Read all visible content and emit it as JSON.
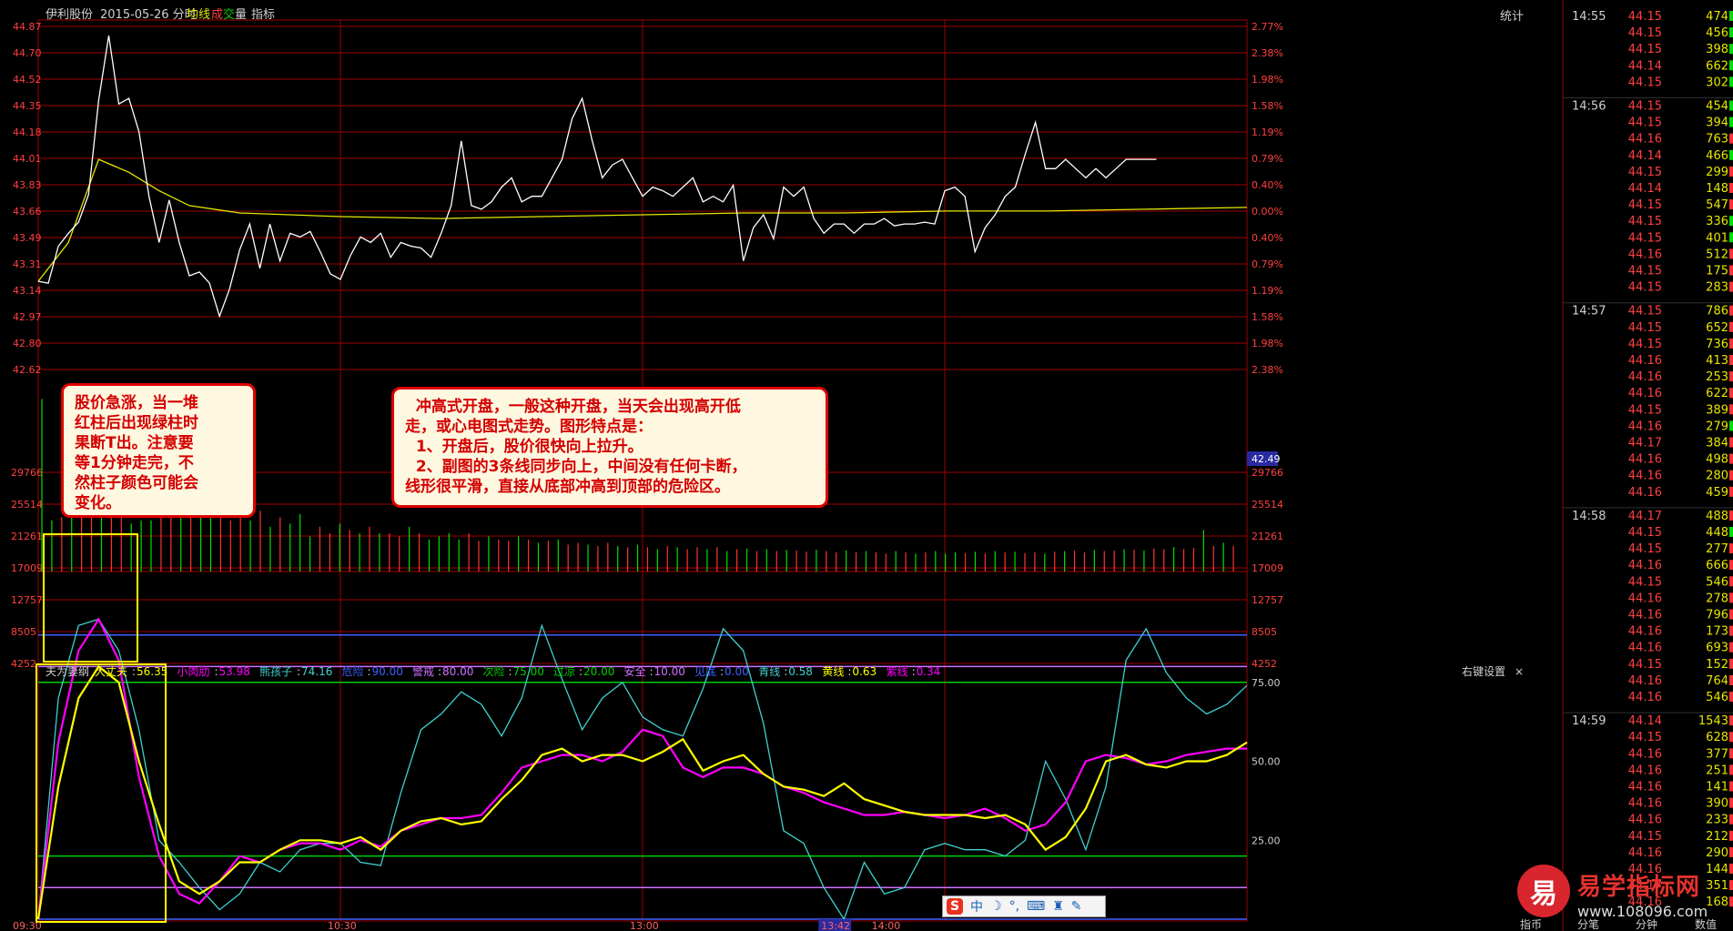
{
  "header": {
    "stock_name": "伊利股份",
    "date_label": "2015-05-26 分时",
    "avg_line_label": "均线",
    "volume_label_cheng": "成",
    "volume_label_jiao": "交",
    "volume_label_liang": "量",
    "indicator_label": "指标",
    "stats_label": "统计"
  },
  "colors": {
    "price_line": "#ffffff",
    "avg_line": "#e6e600",
    "grid_red": "#a00000",
    "up": "#ff3232",
    "down": "#00e000",
    "axis_text_left": "#ff4040",
    "axis_text_right": "#ff4040",
    "ind_cyan": "#40d0d0",
    "ind_magenta": "#ff00ff",
    "ind_yellow": "#ffff00",
    "level_blue": "#4060ff",
    "level_purple": "#d070ff",
    "level_green": "#00d000",
    "highlight_box": "#ffff00"
  },
  "chart_data": {
    "type": "line",
    "price_axis_labels": [
      "44.87",
      "44.70",
      "44.52",
      "44.35",
      "44.18",
      "44.01",
      "43.83",
      "43.66",
      "43.49",
      "43.31",
      "43.14",
      "42.97",
      "42.80",
      "42.62"
    ],
    "percent_axis_labels": [
      "2.77%",
      "2.38%",
      "1.98%",
      "1.58%",
      "1.19%",
      "0.79%",
      "0.40%",
      "0.00%",
      "0.40%",
      "0.79%",
      "1.19%",
      "1.58%",
      "1.98%",
      "2.38%"
    ],
    "current_price_tag": "42.49",
    "volume_axis_labels": [
      "29766",
      "25514",
      "21261",
      "17009",
      "12757",
      "8505",
      "4252"
    ],
    "time_labels": [
      "09:30",
      "10:30",
      "13:00",
      "13:42",
      "14:00"
    ],
    "ylim_price": [
      42.49,
      44.87
    ],
    "price_series": {
      "x": [
        0,
        2,
        4,
        6,
        8,
        10,
        12,
        14,
        16,
        18,
        20,
        22,
        24,
        26,
        28,
        30,
        32,
        34,
        36,
        38,
        40,
        42,
        44,
        46,
        48,
        50,
        52,
        54,
        56,
        58,
        60,
        62,
        64,
        66,
        68,
        70,
        72,
        74,
        76,
        78,
        80,
        82,
        84,
        86,
        88,
        90,
        92,
        94,
        96,
        98,
        100,
        102,
        104,
        106,
        108,
        110,
        112,
        114,
        116,
        118,
        120,
        122,
        124,
        126,
        128,
        130,
        132,
        134,
        136,
        138,
        140,
        142,
        144,
        146,
        148,
        150,
        152,
        154,
        156,
        158,
        160,
        162,
        164,
        166,
        168,
        170,
        172,
        174,
        176,
        178,
        180,
        182,
        184,
        186,
        188,
        190,
        192,
        194,
        196,
        198,
        200,
        202,
        204,
        206,
        208,
        210,
        212,
        214,
        216,
        218,
        220,
        222,
        224,
        226,
        228,
        230,
        232,
        234,
        236,
        238,
        240
      ],
      "values": [
        43.49,
        43.48,
        43.68,
        43.75,
        43.81,
        43.96,
        44.47,
        44.82,
        44.45,
        44.48,
        44.3,
        43.95,
        43.7,
        43.93,
        43.7,
        43.52,
        43.54,
        43.48,
        43.3,
        43.45,
        43.66,
        43.8,
        43.56,
        43.8,
        43.6,
        43.75,
        43.73,
        43.76,
        43.65,
        43.53,
        43.5,
        43.63,
        43.73,
        43.7,
        43.75,
        43.62,
        43.7,
        43.68,
        43.67,
        43.62,
        43.75,
        43.9,
        44.25,
        43.9,
        43.88,
        43.92,
        44.0,
        44.05,
        43.92,
        43.95,
        43.95,
        44.05,
        44.15,
        44.37,
        44.48,
        44.25,
        44.05,
        44.12,
        44.15,
        44.05,
        43.95,
        44.0,
        43.98,
        43.95,
        44.0,
        44.05,
        43.92,
        43.95,
        43.92,
        44.01,
        43.6,
        43.78,
        43.85,
        43.72,
        44.0,
        43.95,
        44.0,
        43.83,
        43.75,
        43.8,
        43.8,
        43.75,
        43.8,
        43.8,
        43.83,
        43.79,
        43.8,
        43.8,
        43.81,
        43.8,
        43.98,
        44.0,
        43.95,
        43.65,
        43.78,
        43.85,
        43.95,
        44.0,
        44.18,
        44.35,
        44.1,
        44.1,
        44.15,
        44.1,
        44.05,
        44.1,
        44.05,
        44.1,
        44.15,
        44.15,
        44.15,
        44.15
      ],
      "name": ""
    },
    "avg_series": {
      "x": [
        0,
        6,
        12,
        18,
        24,
        30,
        40,
        60,
        80,
        100,
        120,
        140,
        160,
        180,
        200,
        220,
        240
      ],
      "values": [
        43.49,
        43.7,
        44.15,
        44.08,
        43.98,
        43.9,
        43.86,
        43.84,
        43.83,
        43.84,
        43.85,
        43.86,
        43.86,
        43.87,
        43.87,
        43.88,
        43.89
      ],
      "name": ""
    },
    "volume_bars": {
      "ylim": [
        0,
        29766
      ],
      "values": [
        27000,
        8000,
        8500,
        9000,
        9500,
        14000,
        8500,
        12000,
        9000,
        7500,
        8000,
        8000,
        9000,
        8500,
        13500,
        8500,
        22000,
        14000,
        9000,
        8000,
        9000,
        8000,
        9500,
        7000,
        8500,
        7500,
        9000,
        5500,
        7000,
        6000,
        7500,
        6500,
        6000,
        7000,
        6000,
        6000,
        5500,
        7000,
        6000,
        5000,
        5500,
        6000,
        5000,
        6000,
        4800,
        5500,
        5000,
        4800,
        5500,
        5000,
        4500,
        4800,
        5000,
        4200,
        4500,
        4200,
        4000,
        4500,
        4000,
        3800,
        4200,
        3800,
        3500,
        4000,
        3800,
        3500,
        3800,
        3500,
        3800,
        3200,
        3500,
        3600,
        3200,
        3500,
        3200,
        3400,
        3300,
        3100,
        3400,
        3200,
        3000,
        3300,
        3000,
        3200,
        3000,
        2800,
        3200,
        3000,
        2800,
        3000,
        3200,
        2800,
        3000,
        2900,
        3100,
        2800,
        3200,
        3000,
        3100,
        2900,
        3000,
        2800,
        3100,
        3200,
        3300,
        3000,
        3400,
        3200,
        3300,
        3500,
        3400,
        3300,
        3600,
        3500,
        3800,
        3500,
        3700,
        6500,
        4000,
        4500,
        4000
      ],
      "directions": "ugrgrrgrruggrrgrgurrrgrgruggrrgrgrgrrgrguggrrgrrgrgrgrrgrrgrgrgrgrrgrgrgrgrgrrgrrgrgrrgrgruggrgrgrgrrgrgrrgrrgrgrrgrrgrgr"
    },
    "indicator": {
      "title": "夫为妻纲",
      "legend": [
        {
          "name": "大丈夫",
          "value": "56.35",
          "color": "#ffff00"
        },
        {
          "name": "小肉肋",
          "value": "53.98",
          "color": "#ff00ff"
        },
        {
          "name": "熊孩子",
          "value": "74.16",
          "color": "#40d0d0"
        },
        {
          "name": "危险",
          "value": "90.00",
          "color": "#4060ff"
        },
        {
          "name": "警戒",
          "value": "80.00",
          "color": "#d070ff"
        },
        {
          "name": "次险",
          "value": "75.00",
          "color": "#00d000"
        },
        {
          "name": "过凉",
          "value": "20.00",
          "color": "#00d000"
        },
        {
          "name": "安全",
          "value": "10.00",
          "color": "#d070ff"
        },
        {
          "name": "见底",
          "value": "0.00",
          "color": "#4060ff"
        },
        {
          "name": "青线",
          "value": "0.58",
          "color": "#40d0d0"
        },
        {
          "name": "黄线",
          "value": "0.63",
          "color": "#ffff00"
        },
        {
          "name": "紫线",
          "value": "0.34",
          "color": "#ff00ff"
        }
      ],
      "right_settings_label": "右键设置",
      "close_label": "×",
      "axis_labels": [
        "75.00",
        "50.00",
        "25.00"
      ],
      "ylim": [
        0,
        100
      ],
      "levels": [
        90,
        80,
        75,
        20,
        10,
        0
      ],
      "x": [
        0,
        4,
        8,
        12,
        16,
        20,
        24,
        28,
        32,
        36,
        40,
        44,
        48,
        52,
        56,
        60,
        64,
        68,
        72,
        76,
        80,
        84,
        88,
        92,
        96,
        100,
        104,
        108,
        112,
        116,
        120,
        124,
        128,
        132,
        136,
        140,
        144,
        148,
        152,
        156,
        160,
        164,
        168,
        172,
        176,
        180,
        184,
        188,
        192,
        196,
        200,
        204,
        208,
        212,
        216,
        220,
        224,
        228,
        232,
        236,
        240
      ],
      "cyan": [
        0,
        70,
        93,
        95,
        85,
        60,
        25,
        18,
        10,
        3,
        8,
        18,
        15,
        22,
        24,
        24,
        18,
        17,
        40,
        60,
        65,
        72,
        68,
        58,
        70,
        93,
        76,
        60,
        70,
        75,
        64,
        60,
        58,
        73,
        92,
        85,
        62,
        28,
        24,
        10,
        0,
        18,
        8,
        10,
        22,
        24,
        22,
        22,
        20,
        25,
        50,
        38,
        22,
        42,
        82,
        92,
        78,
        70,
        65,
        68,
        74
      ],
      "magenta": [
        0,
        56,
        85,
        95,
        82,
        45,
        20,
        8,
        5,
        12,
        20,
        18,
        22,
        24,
        24,
        22,
        25,
        23,
        28,
        30,
        32,
        32,
        33,
        40,
        48,
        50,
        52,
        52,
        50,
        53,
        60,
        58,
        48,
        45,
        48,
        48,
        46,
        42,
        40,
        37,
        35,
        33,
        33,
        34,
        33,
        32,
        33,
        35,
        32,
        28,
        30,
        37,
        50,
        52,
        51,
        49,
        50,
        52,
        53,
        54,
        54
      ],
      "yellow": [
        0,
        42,
        70,
        80,
        75,
        50,
        30,
        12,
        8,
        12,
        18,
        18,
        22,
        25,
        25,
        24,
        26,
        22,
        28,
        31,
        32,
        30,
        31,
        38,
        44,
        52,
        54,
        50,
        52,
        52,
        50,
        53,
        57,
        47,
        50,
        52,
        46,
        42,
        41,
        39,
        43,
        38,
        36,
        34,
        33,
        33,
        33,
        32,
        33,
        30,
        22,
        26,
        35,
        50,
        52,
        49,
        48,
        50,
        50,
        52,
        56
      ]
    },
    "annotations": [
      {
        "text_lines": [
          "股价急涨，当一堆",
          "红柱后出现绿柱时",
          "果断T出。注意要",
          "等1分钟走完，不",
          "然柱子颜色可能会",
          "变化。"
        ]
      },
      {
        "text_lines": [
          "  冲高式开盘，一般这种开盘，当天会出现高开低",
          "走，或心电图式走势。图形特点是：",
          "  1、开盘后，股价很快向上拉升。",
          "  2、副图的3条线同步向上，中间没有任何卡断，",
          "线形很平滑，直接从底部冲高到顶部的危险区。"
        ]
      }
    ]
  },
  "ticks": {
    "time_groups": [
      "14:55",
      "14:56",
      "14:57",
      "14:58",
      "14:59"
    ],
    "rows": [
      [
        "44.15",
        "474",
        "green"
      ],
      [
        "44.15",
        "456",
        "green"
      ],
      [
        "44.15",
        "398",
        "green"
      ],
      [
        "44.14",
        "662",
        "green"
      ],
      [
        "44.15",
        "302",
        "green"
      ],
      [
        "44.15",
        "454",
        "green"
      ],
      [
        "44.15",
        "394",
        "green"
      ],
      [
        "44.16",
        "763",
        "red"
      ],
      [
        "44.14",
        "466",
        "green"
      ],
      [
        "44.15",
        "299",
        "red"
      ],
      [
        "44.14",
        "148",
        "red"
      ],
      [
        "44.15",
        "547",
        "red"
      ],
      [
        "44.15",
        "336",
        "green"
      ],
      [
        "44.15",
        "401",
        "green"
      ],
      [
        "44.16",
        "512",
        "red"
      ],
      [
        "44.15",
        "175",
        "red"
      ],
      [
        "44.15",
        "283",
        "red"
      ],
      [
        "44.15",
        "786",
        "red"
      ],
      [
        "44.15",
        "652",
        "red"
      ],
      [
        "44.15",
        "736",
        "red"
      ],
      [
        "44.16",
        "413",
        "red"
      ],
      [
        "44.16",
        "253",
        "red"
      ],
      [
        "44.16",
        "622",
        "red"
      ],
      [
        "44.15",
        "389",
        "red"
      ],
      [
        "44.16",
        "279",
        "green"
      ],
      [
        "44.17",
        "384",
        "red"
      ],
      [
        "44.16",
        "498",
        "red"
      ],
      [
        "44.16",
        "280",
        "red"
      ],
      [
        "44.16",
        "459",
        "red"
      ],
      [
        "44.17",
        "488",
        "red"
      ],
      [
        "44.15",
        "448",
        "green"
      ],
      [
        "44.15",
        "277",
        "red"
      ],
      [
        "44.16",
        "666",
        "red"
      ],
      [
        "44.15",
        "546",
        "red"
      ],
      [
        "44.16",
        "278",
        "red"
      ],
      [
        "44.16",
        "796",
        "red"
      ],
      [
        "44.16",
        "173",
        "red"
      ],
      [
        "44.16",
        "693",
        "red"
      ],
      [
        "44.15",
        "152",
        "red"
      ],
      [
        "44.16",
        "764",
        "red"
      ],
      [
        "44.16",
        "546",
        "red"
      ],
      [
        "44.14",
        "1543",
        "red"
      ],
      [
        "44.15",
        "628",
        "red"
      ],
      [
        "44.16",
        "377",
        "red"
      ],
      [
        "44.16",
        "251",
        "red"
      ],
      [
        "44.16",
        "141",
        "red"
      ],
      [
        "44.16",
        "390",
        "red"
      ],
      [
        "44.16",
        "233",
        "red"
      ],
      [
        "44.15",
        "212",
        "red"
      ],
      [
        "44.16",
        "290",
        "red"
      ],
      [
        "44.16",
        "144",
        "red"
      ],
      [
        "44.17",
        "351",
        "red"
      ],
      [
        "44.16",
        "168",
        "red"
      ]
    ],
    "group_sizes": [
      5,
      12,
      12,
      12,
      12
    ]
  },
  "bottom_tabs": [
    "指币",
    "分笔",
    "分钟",
    "数值"
  ],
  "ime": {
    "s": "S",
    "lang": "中"
  },
  "logo": {
    "site_name": "易学指标网",
    "mark": "易",
    "url": "www.108096.com"
  }
}
